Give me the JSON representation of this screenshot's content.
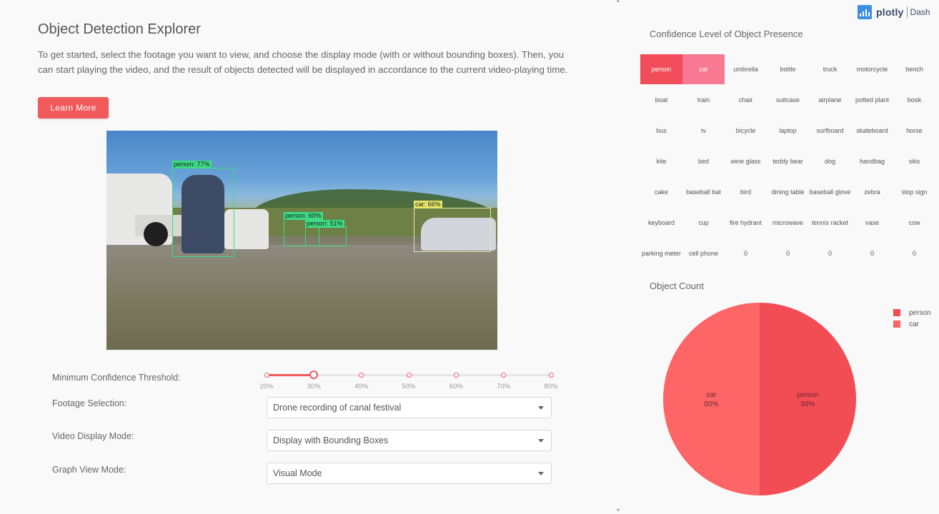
{
  "header": {
    "title": "Object Detection Explorer",
    "description": "To get started, select the footage you want to view, and choose the display mode (with or without bounding boxes). Then, you can start playing the video, and the result of objects detected will be displayed in accordance to the current video-playing time.",
    "learn_more_label": "Learn More"
  },
  "video": {
    "detections": [
      {
        "label": "person: 77%",
        "color": "#3ddc84"
      },
      {
        "label": "person: 60%",
        "color": "#3ddc84"
      },
      {
        "label": "person: 51%",
        "color": "#3ddc84"
      },
      {
        "label": "car: 66%",
        "color": "#e6e66a"
      }
    ]
  },
  "controls": {
    "threshold_label": "Minimum Confidence Threshold:",
    "threshold_value": 30,
    "threshold_marks": [
      "20%",
      "30%",
      "40%",
      "50%",
      "60%",
      "70%",
      "80%"
    ],
    "footage_label": "Footage Selection:",
    "footage_value": "Drone recording of canal festival",
    "display_mode_label": "Video Display Mode:",
    "display_mode_value": "Display with Bounding Boxes",
    "graph_mode_label": "Graph View Mode:",
    "graph_mode_value": "Visual Mode"
  },
  "brand": {
    "name": "plotly",
    "product": "Dash"
  },
  "heatmap": {
    "title": "Confidence Level of Object Presence",
    "cells": [
      "person",
      "car",
      "umbrella",
      "bottle",
      "truck",
      "motorcycle",
      "bench",
      "boat",
      "train",
      "chair",
      "suitcase",
      "airplane",
      "potted plant",
      "book",
      "bus",
      "tv",
      "bicycle",
      "laptop",
      "surfboard",
      "skateboard",
      "horse",
      "kite",
      "bed",
      "wine glass",
      "teddy bear",
      "dog",
      "handbag",
      "skis",
      "cake",
      "baseball bat",
      "bird",
      "dining table",
      "baseball glove",
      "zebra",
      "stop sign",
      "keyboard",
      "cup",
      "fire hydrant",
      "microwave",
      "tennis racket",
      "vase",
      "cow",
      "parking meter",
      "cell phone",
      "0",
      "0",
      "0",
      "0",
      "0"
    ],
    "highlight": {
      "person": "#f24d5a",
      "car": "#f77a92"
    }
  },
  "pie": {
    "title": "Object Count",
    "slices": [
      {
        "name": "person",
        "value": 50,
        "percent": "50%",
        "color": "#f24d54"
      },
      {
        "name": "car",
        "value": 50,
        "percent": "50%",
        "color": "#fd6566"
      }
    ]
  }
}
